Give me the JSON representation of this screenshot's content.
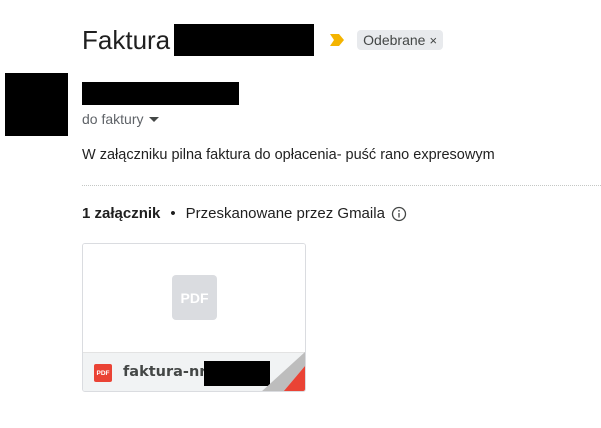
{
  "email": {
    "subject": "Faktura",
    "importance_icon": "importance-marker-icon",
    "label": "Odebrane",
    "label_remove": "×",
    "recipient": "do faktury",
    "body": "W załączniku pilna faktura do opłacenia- puść rano expresowym"
  },
  "attachments": {
    "count_label": "1 załącznik",
    "separator": "•",
    "scan_label": "Przeskanowane przez Gmaila",
    "info_icon": "info-icon",
    "items": [
      {
        "type_label": "PDF",
        "name": "faktura-nr-"
      }
    ]
  },
  "colors": {
    "importance": "#f4b400",
    "pdf_red": "#ea4335",
    "chip_bg": "#e8eaed"
  }
}
